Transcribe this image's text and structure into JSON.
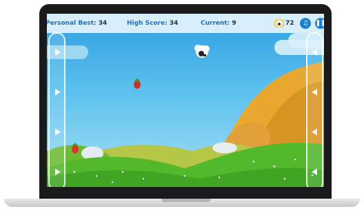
{
  "hud": {
    "personal_best_label": "Personal Best:",
    "personal_best_value": "34",
    "high_score_label": "High Score:",
    "high_score_value": "34",
    "current_label": "Current:",
    "current_value": "9",
    "coins_value": "72"
  },
  "icons": {
    "coin": "sheep-coin-icon",
    "music": "music-note-icon",
    "pause": "pause-icon",
    "left_arrows": "chevron-right-icon",
    "right_arrows": "chevron-left-icon"
  },
  "colors": {
    "hud_text": "#1e6fc8",
    "hud_value": "#22344a",
    "sky_top": "#2f9fe0",
    "grass": "#4fb62b",
    "hill_orange": "#e4a22a",
    "button_blue": "#1e7fd6"
  }
}
